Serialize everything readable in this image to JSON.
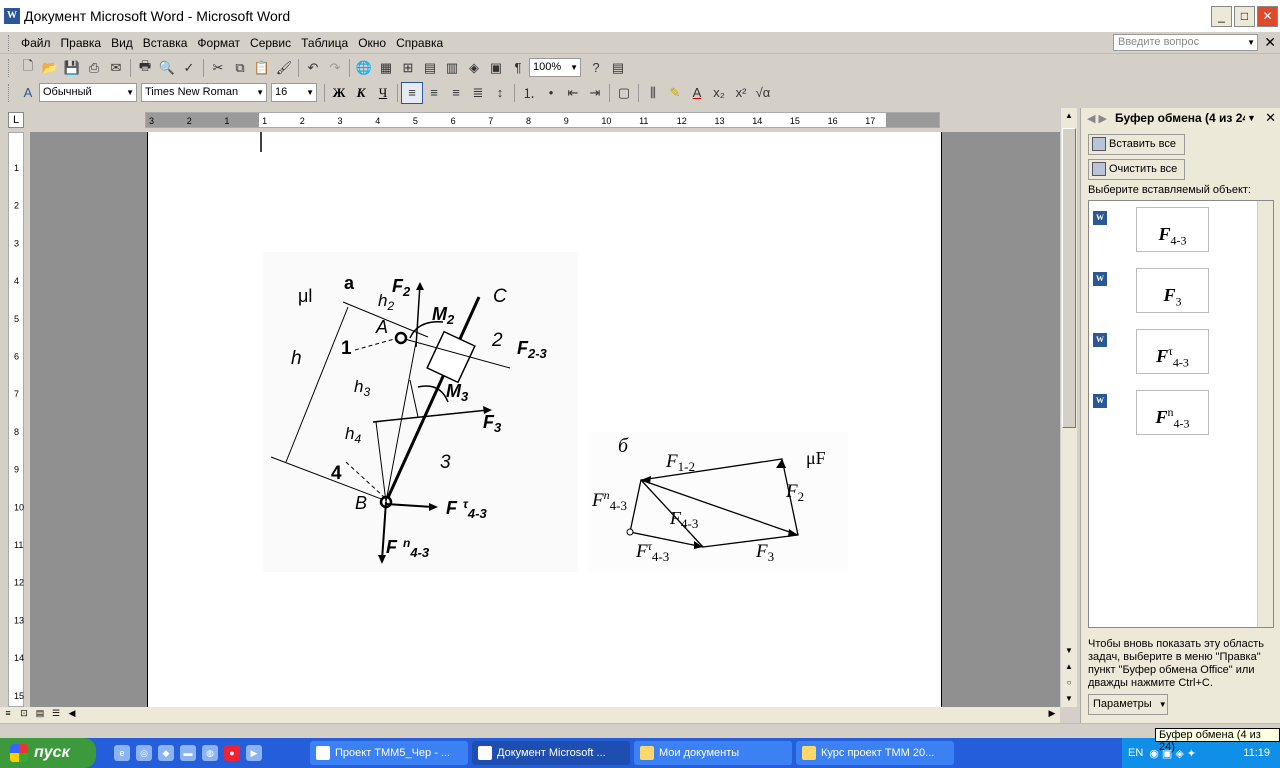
{
  "window": {
    "title": "Документ Microsoft Word - Microsoft Word"
  },
  "menu": {
    "items": [
      "Файл",
      "Правка",
      "Вид",
      "Вставка",
      "Формат",
      "Сервис",
      "Таблица",
      "Окно",
      "Справка"
    ],
    "ask_placeholder": "Введите вопрос"
  },
  "toolbar": {
    "zoom": "100%",
    "style": "Обычный",
    "font": "Times New Roman",
    "size": "16",
    "bold": "Ж",
    "italic": "К",
    "underline": "Ч"
  },
  "ruler": {
    "ticks": [
      "3",
      "2",
      "1",
      "1",
      "2",
      "3",
      "4",
      "5",
      "6",
      "7",
      "8",
      "9",
      "10",
      "11",
      "12",
      "13",
      "14",
      "15",
      "16",
      "17"
    ],
    "vticks": [
      "1",
      "2",
      "3",
      "4",
      "5",
      "6",
      "7",
      "8",
      "9",
      "10",
      "11",
      "12",
      "13",
      "14",
      "15"
    ]
  },
  "figure_a": {
    "mu": "μl",
    "a": "a",
    "F2": "F",
    "F2_sub": "2",
    "h2": "h",
    "h2_sub": "2",
    "C": "C",
    "A": "A",
    "M2": "M",
    "M2_sub": "2",
    "one": "1",
    "two": "2",
    "F23": "F",
    "F23_sub": "2-3",
    "h": "h",
    "h3": "h",
    "h3_sub": "3",
    "M3": "M",
    "M3_sub": "3",
    "F3": "F",
    "F3_sub": "3",
    "h4": "h",
    "h4_sub": "4",
    "four": "4",
    "three": "3",
    "B": "B",
    "Ftau": "F",
    "Ftau_sup": "τ",
    "Ftau_sub": "4-3",
    "Fn": "F",
    "Fn_sup": "n",
    "Fn_sub": "4-3"
  },
  "figure_b": {
    "label": "б",
    "mu": "μF",
    "F12": "F",
    "F12_sub": "1-2",
    "F2": "F",
    "F2_sub": "2",
    "Fn43": "F",
    "Fn43_sup": "n",
    "Fn43_sub": "4-3",
    "F43": "F",
    "F43_sub": "4-3",
    "Ftau43": "F",
    "Ftau43_sup": "τ",
    "Ftau43_sub": "4-3",
    "F3": "F",
    "F3_sub": "3"
  },
  "taskpane": {
    "title": "Буфер обмена (4 из 24)",
    "paste_all": "Вставить все",
    "clear_all": "Очистить все",
    "choose": "Выберите вставляемый объект:",
    "items": [
      {
        "main": "F",
        "sup": "",
        "sub": "4-3"
      },
      {
        "main": "F",
        "sup": "",
        "sub": "3"
      },
      {
        "main": "F",
        "sup": "τ",
        "sub": "4-3"
      },
      {
        "main": "F",
        "sup": "n",
        "sub": "4-3"
      }
    ],
    "info": "Чтобы вновь показать эту область задач, выберите в меню \"Правка\" пункт \"Буфер обмена Office\" или дважды нажмите Ctrl+C.",
    "params": "Параметры",
    "tooltip": "Буфер обмена (4 из 24)"
  },
  "taskbar": {
    "start": "пуск",
    "tasks": [
      "Проект ТММ5_Чер - ...",
      "Документ Microsoft ...",
      "Мои документы",
      "Курс проект ТММ 20..."
    ],
    "lang": "EN",
    "clock": "11:19"
  }
}
